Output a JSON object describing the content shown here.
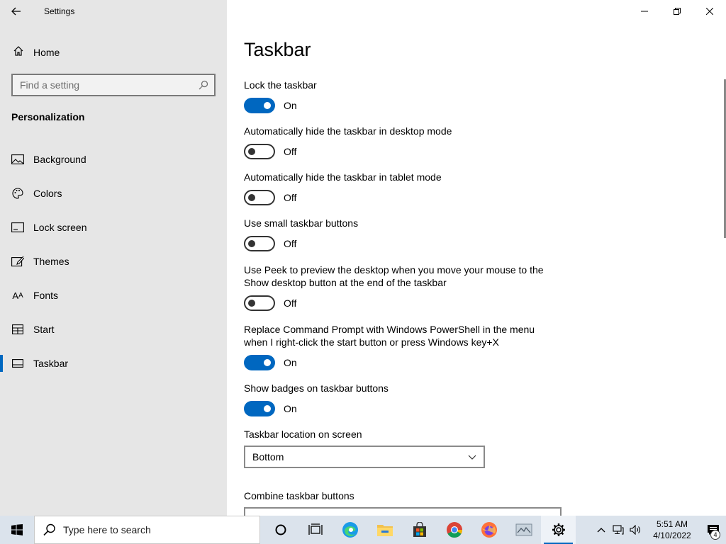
{
  "window": {
    "title": "Settings"
  },
  "sidebar": {
    "home_label": "Home",
    "search_placeholder": "Find a setting",
    "section_title": "Personalization",
    "items": [
      {
        "label": "Background",
        "icon": "picture-icon"
      },
      {
        "label": "Colors",
        "icon": "palette-icon"
      },
      {
        "label": "Lock screen",
        "icon": "lock-screen-icon"
      },
      {
        "label": "Themes",
        "icon": "brush-icon"
      },
      {
        "label": "Fonts",
        "icon": "font-icon"
      },
      {
        "label": "Start",
        "icon": "start-layout-icon"
      },
      {
        "label": "Taskbar",
        "icon": "taskbar-icon",
        "active": true
      }
    ]
  },
  "main": {
    "title": "Taskbar",
    "settings": [
      {
        "label": "Lock the taskbar",
        "state": "On"
      },
      {
        "label": "Automatically hide the taskbar in desktop mode",
        "state": "Off"
      },
      {
        "label": "Automatically hide the taskbar in tablet mode",
        "state": "Off"
      },
      {
        "label": "Use small taskbar buttons",
        "state": "Off"
      },
      {
        "label": "Use Peek to preview the desktop when you move your mouse to the Show desktop button at the end of the taskbar",
        "state": "Off"
      },
      {
        "label": "Replace Command Prompt with Windows PowerShell in the menu when I right-click the start button or press Windows key+X",
        "state": "On"
      },
      {
        "label": "Show badges on taskbar buttons",
        "state": "On"
      }
    ],
    "location_label": "Taskbar location on screen",
    "location_value": "Bottom",
    "combine_label": "Combine taskbar buttons"
  },
  "taskbar": {
    "search_placeholder": "Type here to search",
    "apps": [
      "cortana-icon",
      "task-view-icon",
      "edge-icon",
      "file-explorer-icon",
      "store-icon",
      "chrome-icon",
      "firefox-icon",
      "network-map-icon",
      "settings-gear-icon"
    ],
    "time": "5:51 AM",
    "date": "4/10/2022",
    "notification_count": "4"
  },
  "colors": {
    "accent": "#0067c0",
    "sidebar_bg": "#e6e6e6",
    "taskbar_bg": "#dbe3ec"
  }
}
